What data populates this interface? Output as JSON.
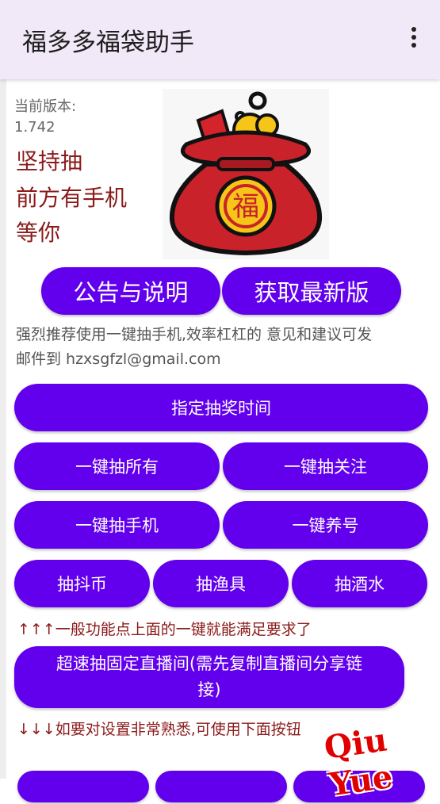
{
  "app": {
    "title": "福多多福袋助手",
    "menu_icon": "more-vert-icon"
  },
  "version": {
    "label": "当前版本:",
    "number": "1.742"
  },
  "slogan": [
    "坚持抽",
    "前方有手机",
    "等你"
  ],
  "top_buttons": {
    "announcement": "公告与说明",
    "latest": "获取最新版"
  },
  "recommend": {
    "line1": "强烈推荐使用一键抽手机,效率杠杠的 意见和建议可发",
    "line2": "邮件到 hzxsgfzl@gmail.com"
  },
  "buttons": {
    "schedule": "指定抽奖时间",
    "all": "一键抽所有",
    "follow": "一键抽关注",
    "phone": "一键抽手机",
    "nurture": "一键养号",
    "coin": "抽抖币",
    "fishing": "抽渔具",
    "liquor": "抽酒水",
    "fixed_live": "超速抽固定直播间(需先复制直播间分享链接)"
  },
  "notes": {
    "up": "↑↑↑一般功能点上面的一键就能满足要求了",
    "down": "↓↓↓如要对设置非常熟悉,可使用下面按钮"
  },
  "watermark": "Qiu  Yue",
  "colors": {
    "accent": "#6200ee",
    "appbar": "#f1e8f8",
    "slogan": "#8b1a1a"
  }
}
